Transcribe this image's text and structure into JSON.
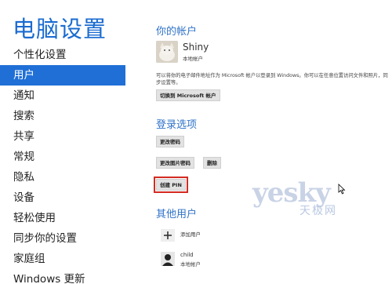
{
  "app_title": "电脑设置",
  "sidebar": {
    "items": [
      {
        "label": "个性化设置"
      },
      {
        "label": "用户",
        "selected": true
      },
      {
        "label": "通知"
      },
      {
        "label": "搜索"
      },
      {
        "label": "共享"
      },
      {
        "label": "常规"
      },
      {
        "label": "隐私"
      },
      {
        "label": "设备"
      },
      {
        "label": "轻松使用"
      },
      {
        "label": "同步你的设置"
      },
      {
        "label": "家庭组"
      },
      {
        "label": "Windows 更新"
      }
    ]
  },
  "account": {
    "section_title": "你的帐户",
    "name": "Shiny",
    "type": "本地帐户",
    "description": "可以将你的电子邮件地址作为 Microsoft 帐户以登录到 Windows。你可以在任意位置访问文件和照片，同步设置等。",
    "switch_button": "切换到 Microsoft 帐户"
  },
  "signin": {
    "section_title": "登录选项",
    "change_password": "更改密码",
    "change_picture_password": "更改图片密码",
    "delete": "删除",
    "create_pin": "创建 PIN"
  },
  "other_users": {
    "section_title": "其他用户",
    "add_user": "添加用户",
    "users": [
      {
        "name": "child",
        "type": "本地帐户"
      }
    ]
  },
  "watermark": {
    "text": "yesky",
    "subtext": "天极网"
  },
  "colors": {
    "accent": "#1f6fd6",
    "section_title": "#2f73c8",
    "highlight_border": "#d42b22"
  }
}
